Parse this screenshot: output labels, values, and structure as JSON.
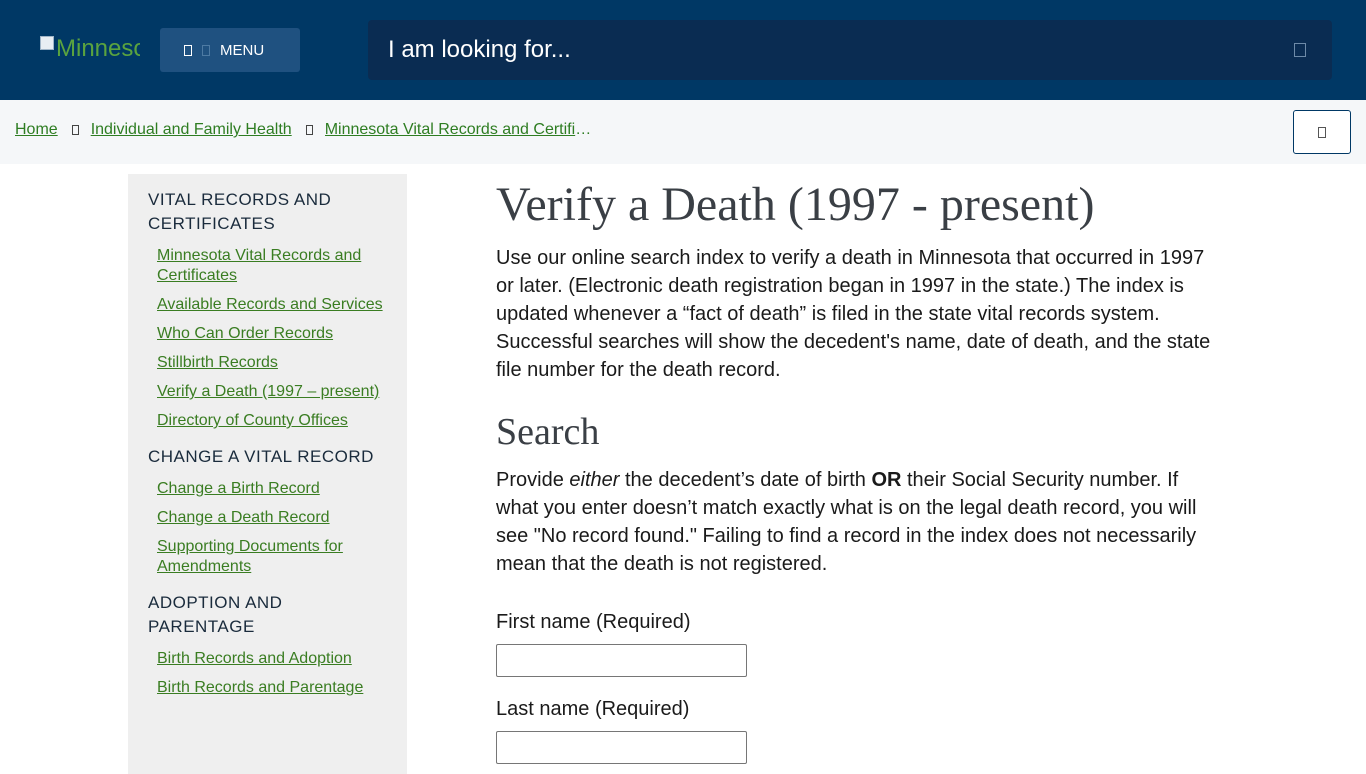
{
  "header": {
    "logo_alt": "Minnesota",
    "menu_label": "MENU",
    "search_placeholder": "I am looking for..."
  },
  "breadcrumb": {
    "items": [
      "Home",
      "Individual and Family Health",
      "Minnesota Vital Records and Certificates"
    ]
  },
  "sidebar": {
    "sections": [
      {
        "heading": "VITAL RECORDS AND CERTIFICATES",
        "links": [
          "Minnesota Vital Records and Certificates",
          "Available Records and Services",
          "Who Can Order Records",
          "Stillbirth Records",
          "Verify a Death (1997 – present)",
          "Directory of County Offices"
        ]
      },
      {
        "heading": "CHANGE A VITAL RECORD",
        "links": [
          "Change a Birth Record",
          "Change a Death Record",
          "Supporting Documents for Amendments"
        ]
      },
      {
        "heading": "ADOPTION AND PARENTAGE",
        "links": [
          "Birth Records and Adoption",
          "Birth Records and Parentage"
        ]
      }
    ]
  },
  "main": {
    "title": "Verify a Death (1997 - present)",
    "intro": "Use our online search index to verify a death in Minnesota that occurred in 1997 or later. (Electronic death registration began in 1997 in the state.) The index is updated whenever a “fact of death” is filed in the state vital records system. Successful searches will show the decedent's name, date of death, and the state file number for the death record.",
    "search_heading": "Search",
    "provide": {
      "part1": "Provide ",
      "either": "either",
      "part2": " the decedent’s date of birth ",
      "or": "OR",
      "part3": " their Social Security number. If what you enter doesn’t match exactly what is on the legal death record, you will see \"No record found.\" Failing to find a record in the index does not necessarily mean that the death is not registered."
    },
    "form": {
      "first_name_label": "First name (Required)",
      "last_name_label": "Last name (Required)"
    }
  }
}
